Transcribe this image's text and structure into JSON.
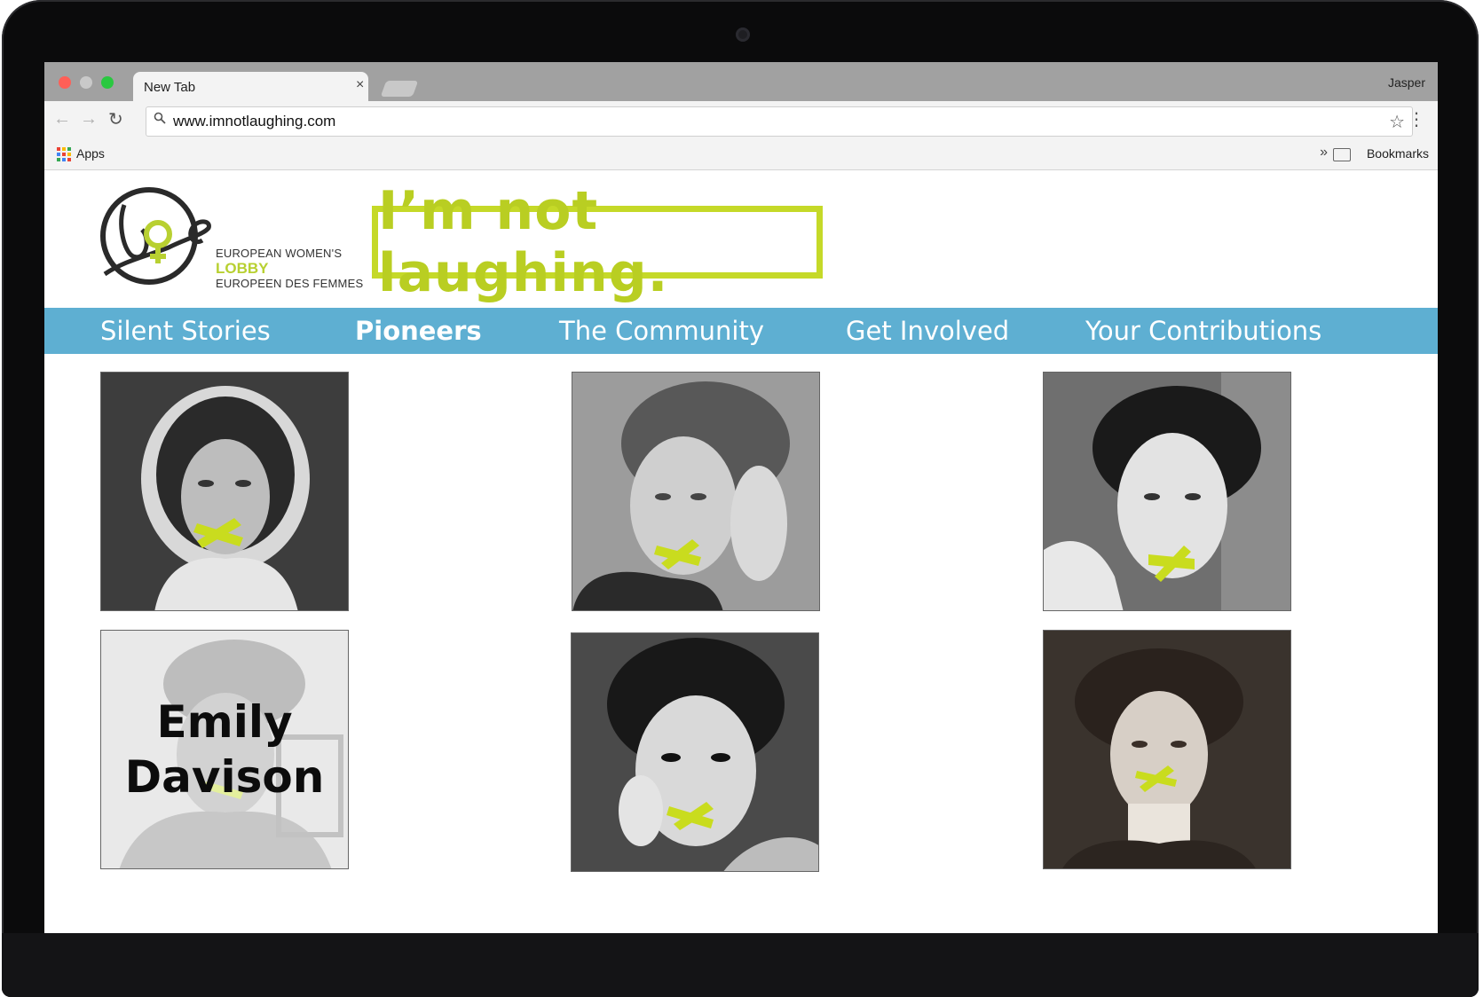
{
  "browser": {
    "tab_title": "New Tab",
    "tab_close": "×",
    "profile_name": "Jasper",
    "url": "www.imnotlaughing.com",
    "bookmarks_bar": {
      "apps_label": "Apps",
      "overflow": "»",
      "folder_label": "Bookmarks"
    }
  },
  "site": {
    "logo": {
      "mark": "ewl",
      "line1": "EUROPEAN WOMEN'S",
      "line2": "LOBBY",
      "line3": "EUROPEEN DES FEMMES"
    },
    "slogan": "I’m not laughing.",
    "nav": [
      {
        "label": "Silent Stories",
        "active": false
      },
      {
        "label": "Pioneers",
        "active": true
      },
      {
        "label": "The Community",
        "active": false
      },
      {
        "label": "Get Involved",
        "active": false
      },
      {
        "label": "Your Contributions",
        "active": false
      }
    ],
    "portraits": [
      {
        "caption": ""
      },
      {
        "caption": ""
      },
      {
        "caption": ""
      },
      {
        "caption": "Emily Davison",
        "caption_line1": "Emily",
        "caption_line2": "Davison",
        "hovered": true
      },
      {
        "caption": ""
      },
      {
        "caption": ""
      }
    ]
  },
  "colors": {
    "accent_green": "#c5d928",
    "nav_blue": "#5eafd2",
    "tape_yellow": "#c9dc1e"
  },
  "icons": [
    "back-arrow-icon",
    "forward-arrow-icon",
    "reload-icon",
    "search-icon",
    "star-icon",
    "menu-dots-icon",
    "apps-grid-icon",
    "folder-icon",
    "mouse-cursor-icon"
  ]
}
